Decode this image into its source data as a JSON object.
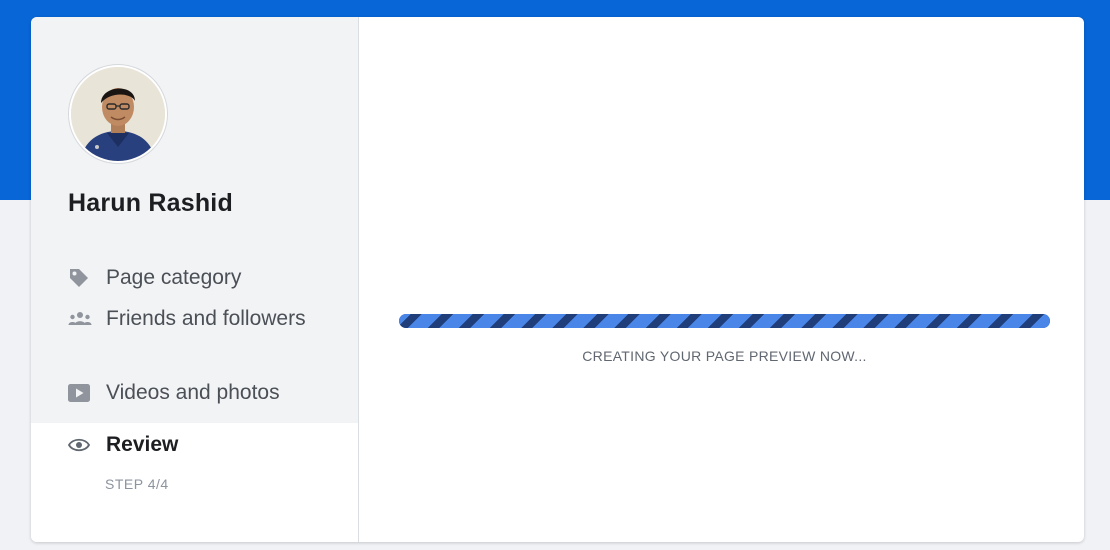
{
  "colors": {
    "brand_blue": "#0866d6",
    "progress_fill": "#4a86e8",
    "sidebar_bg": "#f2f3f5"
  },
  "profile": {
    "name": "Harun Rashid",
    "avatar_icon": "profile-photo"
  },
  "steps": [
    {
      "label": "Page category",
      "icon": "tag-icon"
    },
    {
      "label": "Friends and followers",
      "icon": "people-icon"
    },
    {
      "label": "Videos and photos",
      "icon": "video-icon"
    },
    {
      "label": "Review",
      "icon": "eye-icon",
      "active": true
    }
  ],
  "step_counter": "STEP 4/4",
  "progress": {
    "percent": 100,
    "label": "CREATING YOUR PAGE PREVIEW NOW..."
  }
}
